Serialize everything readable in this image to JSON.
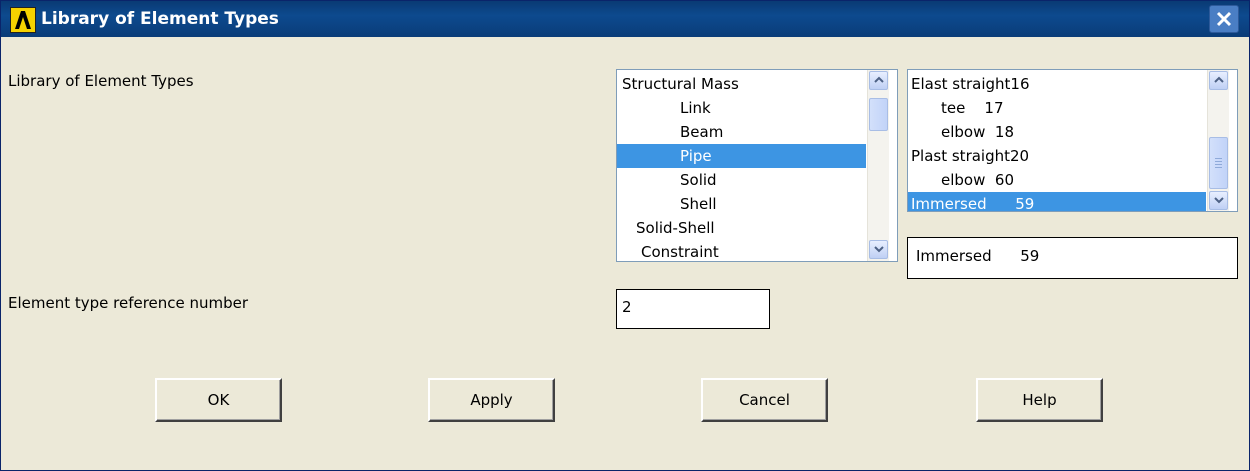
{
  "window": {
    "title": "Library of Element Types"
  },
  "labels": {
    "library": "Library of Element Types",
    "ref_number": "Element type reference number"
  },
  "category_list": {
    "items": [
      "Structural Mass",
      "Link",
      "Beam",
      "Pipe",
      "Solid",
      "Shell",
      "Solid-Shell",
      "Constraint"
    ],
    "selected": "Pipe"
  },
  "type_list": {
    "items": [
      "Elast straight16",
      "tee    17",
      "elbow  18",
      "Plast straight20",
      "elbow  60",
      "Immersed      59"
    ],
    "selected": "Immersed      59"
  },
  "selection_display": "Immersed      59",
  "ref_number_value": "2",
  "buttons": {
    "ok": "OK",
    "apply": "Apply",
    "cancel": "Cancel",
    "help": "Help"
  },
  "icons": {
    "app": "ansys-logo-icon",
    "close": "close-icon"
  },
  "colors": {
    "titlebar": "#0d4a8e",
    "selection": "#3d95e3",
    "dialog_bg": "#ece9d8"
  }
}
